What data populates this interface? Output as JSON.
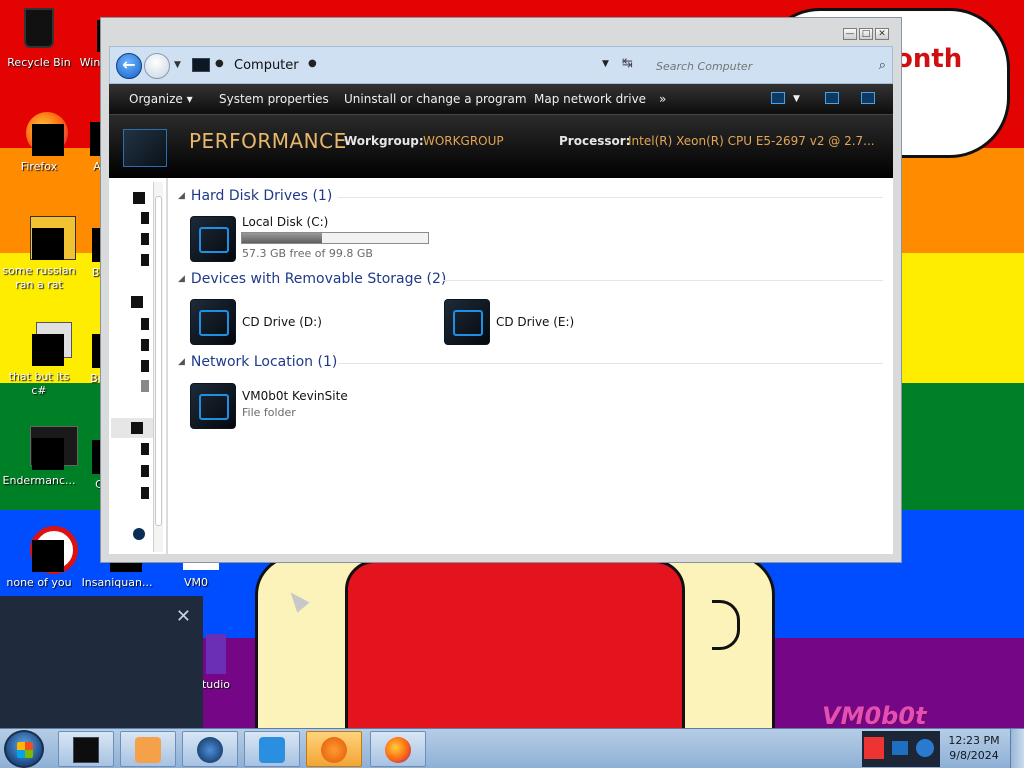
{
  "desktop": {
    "icons": [
      {
        "label": "Recycle Bin",
        "icon": "recycle-bin-icon"
      },
      {
        "label": "Win",
        "icon": "window-icon"
      },
      {
        "label": "Firefox",
        "icon": "firefox-icon"
      },
      {
        "label": "A",
        "icon": "app-icon"
      },
      {
        "label": "some russian ran a rat",
        "icon": "russian-rat-icon"
      },
      {
        "label": "Be",
        "icon": "app-icon"
      },
      {
        "label": "that but its c#",
        "icon": "csharp-icon"
      },
      {
        "label": "Big",
        "icon": "app-icon"
      },
      {
        "label": "Endermanc...",
        "icon": "enderman-icon"
      },
      {
        "label": "C",
        "icon": "app-icon"
      },
      {
        "label": "none of you",
        "icon": "none-of-you-icon"
      },
      {
        "label": "Insaniquan...",
        "icon": "insaniquan-icon"
      },
      {
        "label": "VM0",
        "icon": "vm-icon"
      },
      {
        "label": "tudio",
        "icon": "visual-studio-icon"
      }
    ],
    "bubble_text": "onth",
    "watermark": "VM0b0t"
  },
  "colors": {
    "red": "#e40303",
    "orange": "#ff8c00",
    "yellow": "#ffed00",
    "green": "#008026",
    "blue": "#004dff",
    "purple": "#750787",
    "accent_link": "#1e3a8a",
    "detail_value": "#e3a556"
  },
  "window": {
    "controls": {
      "minimize": "—",
      "maximize": "□",
      "close": "✕"
    },
    "address": {
      "location": "Computer",
      "search_placeholder": "Search Computer"
    },
    "toolbar": {
      "organize": "Organize ▾",
      "system_properties": "System properties",
      "uninstall": "Uninstall or change a program",
      "map_drive": "Map network drive",
      "more": "»"
    },
    "details": {
      "name": "PERFORMANCE",
      "workgroup_label": "Workgroup:",
      "workgroup_value": "WORKGROUP",
      "processor_label": "Processor:",
      "processor_value": "Intel(R) Xeon(R) CPU E5-2697 v2 @ 2.7..."
    },
    "groups": {
      "hdd": {
        "header": "Hard Disk Drives (1)",
        "items": [
          {
            "name": "Local Disk (C:)",
            "sub": "57.3 GB free of 99.8 GB",
            "used_fraction": 0.43
          }
        ]
      },
      "removable": {
        "header": "Devices with Removable Storage (2)",
        "items": [
          {
            "name": "CD Drive (D:)"
          },
          {
            "name": "CD Drive (E:)"
          }
        ]
      },
      "network": {
        "header": "Network Location (1)",
        "items": [
          {
            "name": "VM0b0t KevinSite",
            "sub": "File folder"
          }
        ]
      }
    }
  },
  "notification": {
    "close": "✕"
  },
  "taskbar": {
    "clock_time": "12:23 PM",
    "clock_date": "9/8/2024"
  }
}
